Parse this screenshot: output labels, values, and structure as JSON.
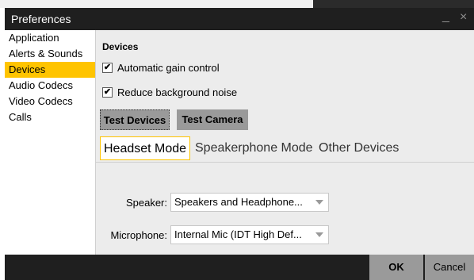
{
  "window": {
    "title": "Preferences",
    "minimize_glyph": "_",
    "close_glyph": "×"
  },
  "sidebar": {
    "items": [
      {
        "label": "Application",
        "active": false
      },
      {
        "label": "Alerts & Sounds",
        "active": false
      },
      {
        "label": "Devices",
        "active": true
      },
      {
        "label": "Audio Codecs",
        "active": false
      },
      {
        "label": "Video Codecs",
        "active": false
      },
      {
        "label": "Calls",
        "active": false
      }
    ]
  },
  "devices": {
    "section_title": "Devices",
    "options": [
      {
        "label": "Automatic gain control",
        "checked": true
      },
      {
        "label": "Reduce background noise",
        "checked": true
      }
    ],
    "buttons": {
      "test_devices": "Test Devices",
      "test_camera": "Test Camera"
    },
    "tabs": [
      {
        "label": "Headset Mode",
        "active": true
      },
      {
        "label": "Speakerphone Mode",
        "active": false
      },
      {
        "label": "Other Devices",
        "active": false
      }
    ],
    "speaker": {
      "label": "Speaker:",
      "value": "Speakers and Headphone..."
    },
    "microphone": {
      "label": "Microphone:",
      "value": "Internal Mic (IDT High Def..."
    }
  },
  "footer": {
    "ok_label": "OK",
    "cancel_label": "Cancel"
  },
  "colors": {
    "accent": "#ffc400",
    "titlebar": "#1f1f1f",
    "button": "#9a9a9a",
    "panel": "#ececec"
  },
  "icons": {
    "check": "✔"
  }
}
